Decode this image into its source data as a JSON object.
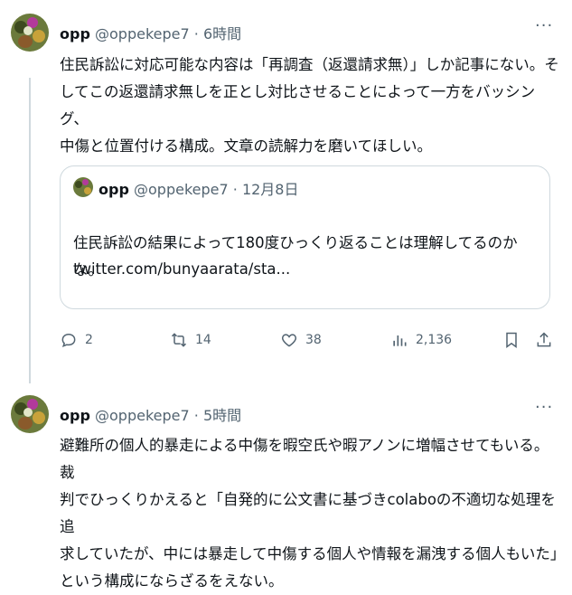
{
  "tweets": [
    {
      "name": "opp",
      "handle": "@oppekepe7",
      "time": "· 6時間",
      "more": "···",
      "text_lines": [
        "住民訴訟に対応可能な内容は「再調査（返還請求無）」しか記事にない。そ",
        "してこの返還請求無しを正とし対比させることによって一方をバッシング、",
        "中傷と位置付ける構成。文章の読解力を磨いてほしい。"
      ],
      "quote": {
        "name": "opp",
        "handle": "@oppekepe7",
        "time": "· 12月8日",
        "text": "住民訴訟の結果によって180度ひっくり返ることは理解してるのかな。",
        "link": "twitter.com/bunyaarata/sta..."
      },
      "actions": {
        "reply_count": "2",
        "retweet_count": "14",
        "like_count": "38",
        "views_count": "2,136"
      }
    },
    {
      "name": "opp",
      "handle": "@oppekepe7",
      "time": "· 5時間",
      "more": "···",
      "text_lines": [
        "避難所の個人的暴走による中傷を暇空氏や暇アノンに増幅させてもいる。裁",
        "判でひっくりかえると「自発的に公文書に基づきcolaboの不適切な処理を追",
        "求していたが、中には暴走して中傷する個人や情報を漏洩する個人もいた」",
        "という構成にならざるをえない。"
      ]
    }
  ],
  "colors": {
    "text": "#0f1419",
    "secondary": "#536471",
    "border": "#cfd9de"
  },
  "icons": [
    "reply-icon",
    "retweet-icon",
    "like-icon",
    "views-icon",
    "bookmark-icon",
    "share-icon",
    "more-icon"
  ]
}
